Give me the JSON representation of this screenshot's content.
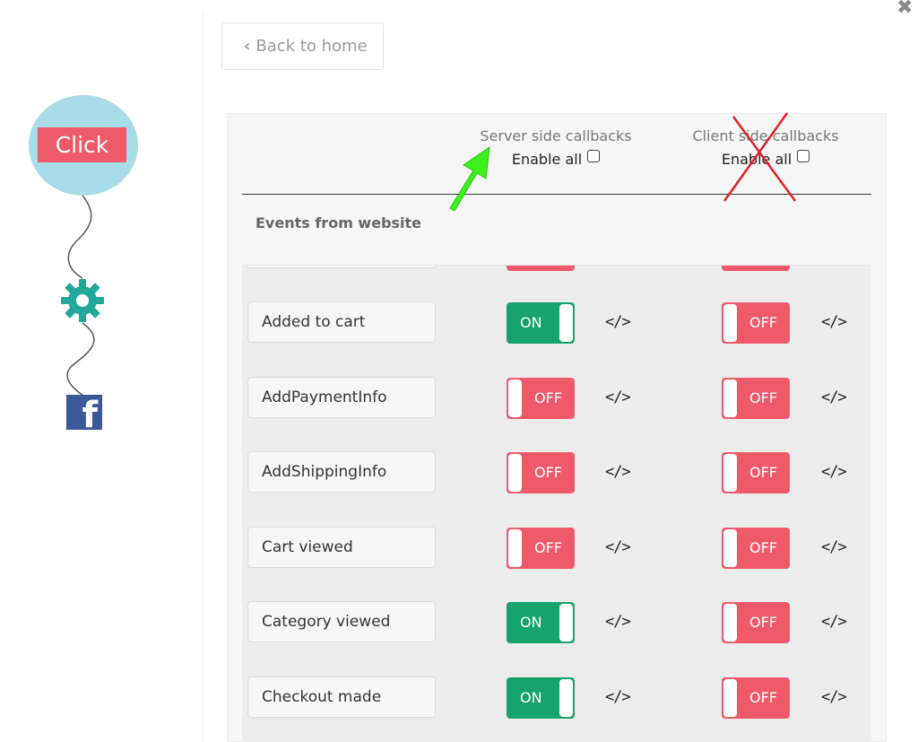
{
  "illustration": {
    "click_label": "Click",
    "facebook_glyph": "f",
    "icons": [
      "gear-icon",
      "facebook-icon"
    ],
    "colors": {
      "circle": "#a8dce8",
      "click": "#ee5a6a",
      "gear": "#22a79a",
      "facebook": "#3b5998"
    }
  },
  "close_glyph": "✖",
  "back_button": {
    "chevron": "‹",
    "label": "Back to home"
  },
  "columns": {
    "server": {
      "title": "Server side callbacks",
      "enable_all": "Enable all"
    },
    "client": {
      "title": "Client side callbacks",
      "enable_all": "Enable all"
    }
  },
  "section_title": "Events from website",
  "events": [
    {
      "name": "Added to cart",
      "server": "ON",
      "client": "OFF",
      "server_code": "</>",
      "client_code": "</>"
    },
    {
      "name": "AddPaymentInfo",
      "server": "OFF",
      "client": "OFF",
      "server_code": "</>",
      "client_code": "</>"
    },
    {
      "name": "AddShippingInfo",
      "server": "OFF",
      "client": "OFF",
      "server_code": "</>",
      "client_code": "</>"
    },
    {
      "name": "Cart viewed",
      "server": "OFF",
      "client": "OFF",
      "server_code": "</>",
      "client_code": "</>"
    },
    {
      "name": "Category viewed",
      "server": "ON",
      "client": "OFF",
      "server_code": "</>",
      "client_code": "</>"
    },
    {
      "name": "Checkout made",
      "server": "ON",
      "client": "OFF",
      "server_code": "</>",
      "client_code": "</>"
    }
  ],
  "toggle_colors": {
    "on": "#17a36d",
    "off": "#ef5a6b"
  },
  "annotations": {
    "arrow_color": "#3df21c",
    "cross_color": "#e0202a"
  }
}
